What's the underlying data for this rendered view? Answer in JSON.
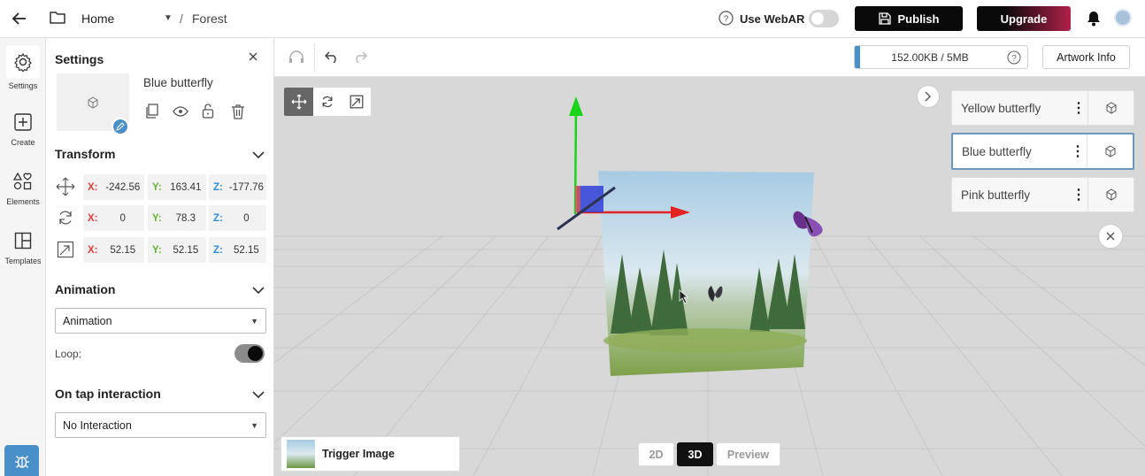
{
  "topbar": {
    "home_label": "Home",
    "breadcrumb_sep": "/",
    "project_name": "Forest",
    "webar_label": "Use WebAR",
    "publish_label": "Publish",
    "upgrade_label": "Upgrade"
  },
  "rail": {
    "items": [
      {
        "label": "Settings",
        "icon": "gear-icon"
      },
      {
        "label": "Create",
        "icon": "plus-square-icon"
      },
      {
        "label": "Elements",
        "icon": "shapes-icon"
      },
      {
        "label": "Templates",
        "icon": "layout-icon"
      }
    ],
    "bug_icon": "bug-icon"
  },
  "panel": {
    "title": "Settings",
    "object_name": "Blue butterfly",
    "transform_title": "Transform",
    "position": {
      "x": "-242.56",
      "y": "163.41",
      "z": "-177.76"
    },
    "rotation": {
      "x": "0",
      "y": "78.3",
      "z": "0"
    },
    "scale": {
      "x": "52.15",
      "y": "52.15",
      "z": "52.15"
    },
    "axis_x": "X:",
    "axis_y": "Y:",
    "axis_z": "Z:",
    "animation_title": "Animation",
    "animation_select": "Animation",
    "loop_label": "Loop:",
    "loop_on": true,
    "tap_title": "On tap interaction",
    "tap_select": "No Interaction"
  },
  "toolbar": {
    "storage": "152.00KB / 5MB",
    "storage_fraction": 0.03,
    "artwork_info_label": "Artwork Info"
  },
  "scene_objects": [
    {
      "name": "Yellow butterfly",
      "selected": false
    },
    {
      "name": "Blue butterfly",
      "selected": true
    },
    {
      "name": "Pink butterfly",
      "selected": false
    }
  ],
  "bottom": {
    "trigger_label": "Trigger Image",
    "mode_2d": "2D",
    "mode_3d": "3D",
    "mode_preview": "Preview"
  },
  "colors": {
    "accent_blue": "#4a90c8",
    "axis_x": "#e03a3a",
    "axis_y": "#62b236",
    "axis_z": "#2f8fd8",
    "upgrade_gradient_end": "#b0204a"
  }
}
